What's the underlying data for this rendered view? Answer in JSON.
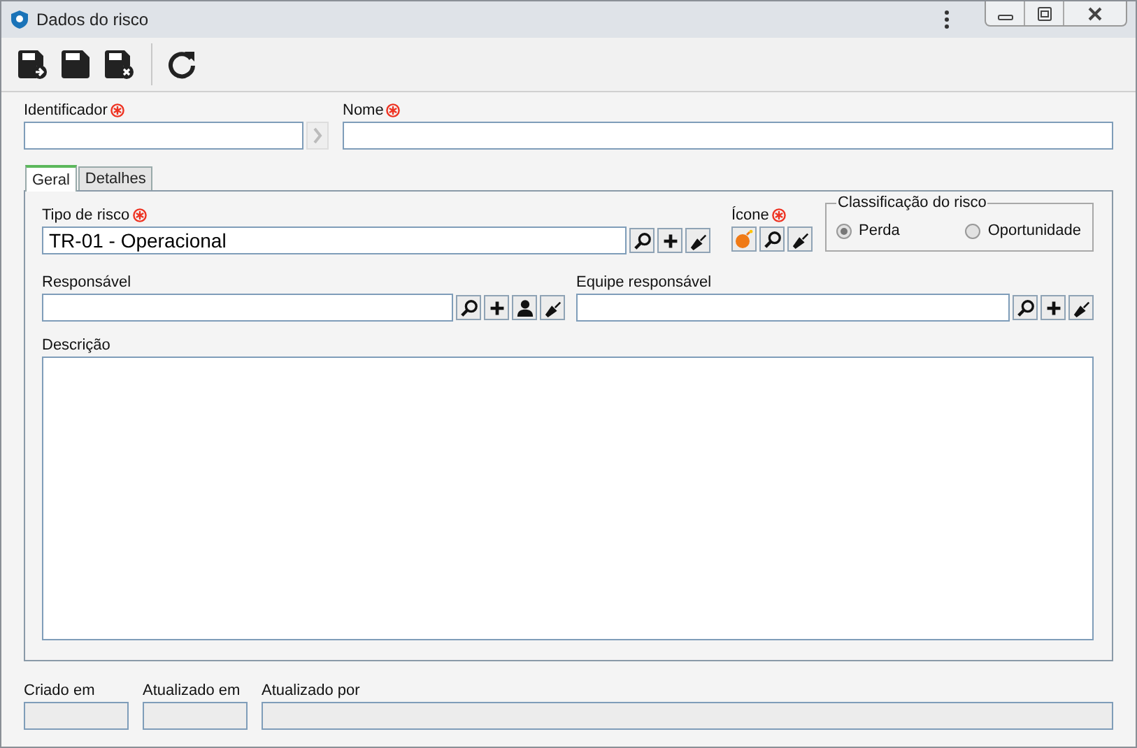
{
  "window": {
    "title": "Dados do risco"
  },
  "header_fields": [
    {
      "label": "Identificador",
      "required": true,
      "kind": "id"
    },
    {
      "label": "Nome",
      "required": true,
      "kind": "text"
    }
  ],
  "tabs": [
    {
      "label": "Geral",
      "selected": true
    },
    {
      "label": "Detalhes",
      "selected": false
    }
  ],
  "risk_type": {
    "label": "Tipo de risco",
    "required": true,
    "value": "TR-01 - Operacional"
  },
  "icon_field": {
    "label": "Ícone",
    "required": true
  },
  "classification": {
    "legend": "Classificação do risco",
    "options": [
      {
        "label": "Perda",
        "selected": true
      },
      {
        "label": "Oportunidade",
        "selected": false
      }
    ]
  },
  "responsible": {
    "label": "Responsável"
  },
  "responsible_team": {
    "label": "Equipe responsável"
  },
  "description": {
    "label": "Descrição"
  },
  "footer_fields": [
    {
      "label": "Criado em",
      "disabled": true
    },
    {
      "label": "Atualizado em",
      "disabled": true
    },
    {
      "label": "Atualizado por",
      "disabled": true
    }
  ]
}
